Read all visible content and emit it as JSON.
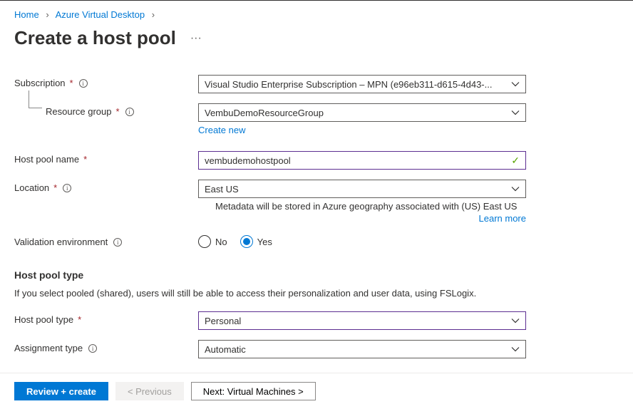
{
  "breadcrumb": {
    "home": "Home",
    "avd": "Azure Virtual Desktop"
  },
  "page_title": "Create a host pool",
  "fields": {
    "subscription": {
      "label": "Subscription",
      "value": "Visual Studio Enterprise Subscription – MPN (e96eb311-d615-4d43-..."
    },
    "resource_group": {
      "label": "Resource group",
      "value": "VembuDemoResourceGroup",
      "create_link": "Create new"
    },
    "host_pool_name": {
      "label": "Host pool name",
      "value": "vembudemohostpool"
    },
    "location": {
      "label": "Location",
      "value": "East US",
      "helper": "Metadata will be stored in Azure geography associated with (US) East US",
      "learn_more": "Learn more"
    },
    "validation_env": {
      "label": "Validation environment",
      "no_label": "No",
      "yes_label": "Yes",
      "selected": "yes"
    },
    "host_pool_type_section": {
      "heading": "Host pool type",
      "desc": "If you select pooled (shared), users will still be able to access their personalization and user data, using FSLogix."
    },
    "host_pool_type": {
      "label": "Host pool type",
      "value": "Personal"
    },
    "assignment_type": {
      "label": "Assignment type",
      "value": "Automatic"
    }
  },
  "footer": {
    "review": "Review + create",
    "previous": "< Previous",
    "next": "Next: Virtual Machines >"
  }
}
